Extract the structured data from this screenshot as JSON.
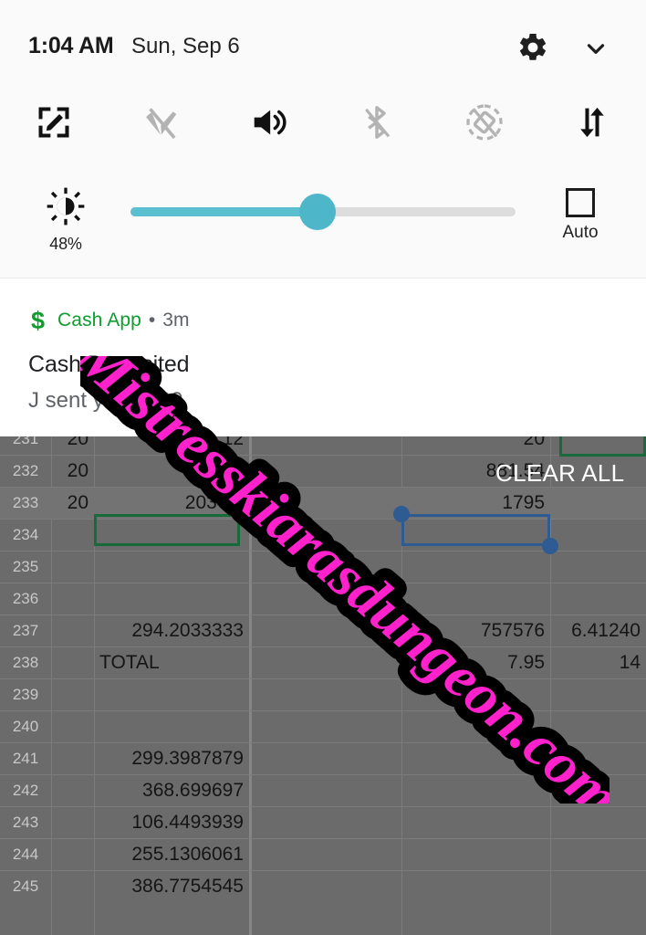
{
  "status_bar": {
    "time": "1:04 AM",
    "date": "Sun, Sep 6",
    "settings_icon": "gear-icon",
    "collapse_icon": "chevron-down-icon"
  },
  "quick_settings": {
    "tiles": [
      {
        "name": "screenshot-edit-tile",
        "icon": "screenshot-edit-icon",
        "active": true
      },
      {
        "name": "wifi-tile",
        "icon": "wifi-off-icon",
        "active": false
      },
      {
        "name": "sound-tile",
        "icon": "volume-up-icon",
        "active": true
      },
      {
        "name": "bluetooth-tile",
        "icon": "bluetooth-off-icon",
        "active": false
      },
      {
        "name": "auto-rotate-tile",
        "icon": "rotate-lock-icon",
        "active": false
      },
      {
        "name": "mobile-data-tile",
        "icon": "data-transfer-icon",
        "active": true
      }
    ],
    "brightness": {
      "icon": "brightness-icon",
      "percent_label": "48%",
      "value": 48,
      "auto_label": "Auto",
      "auto_checked": false,
      "fill_color": "#5bbfd0",
      "track_color": "#dcdcdc"
    }
  },
  "notification": {
    "app_icon": "dollar-sign-icon",
    "app_icon_glyph": "$",
    "app_name": "Cash App",
    "separator": "•",
    "time_ago": "3m",
    "title": "Cash Deposited",
    "body": "J                            sent you $100.",
    "app_color": "#0f9d2f"
  },
  "clear_all": {
    "label": "CLEAR ALL"
  },
  "watermark": {
    "text": "Mistresskiarasdungeon.com",
    "fill_color": "#ff22cc",
    "stroke_color": "#000000"
  },
  "spreadsheet": {
    "row_start": 231,
    "rows": [
      {
        "num": "231",
        "c1": "20",
        "c2": "12",
        "c3": "",
        "c4": "20",
        "c5": ""
      },
      {
        "num": "232",
        "c1": "20",
        "c2": "1058.1",
        "c3": "",
        "c4": "881.54",
        "c5": ""
      },
      {
        "num": "233",
        "c1": "20",
        "c2": "2034.9",
        "c3": "",
        "c4": "1795",
        "c5": ""
      },
      {
        "num": "234",
        "c1": "",
        "c2": "",
        "c3": "",
        "c4": "",
        "c5": ""
      },
      {
        "num": "235",
        "c1": "",
        "c2": "",
        "c3": "",
        "c4": "",
        "c5": ""
      },
      {
        "num": "236",
        "c1": "",
        "c2": "",
        "c3": "",
        "c4": "",
        "c5": ""
      },
      {
        "num": "237",
        "c1": "",
        "c2": "294.2033333",
        "c3": "",
        "c4": "757576",
        "c5": "6.41240"
      },
      {
        "num": "238",
        "c1": "",
        "c2": "TOTAL",
        "c3": "",
        "c4": "7.95",
        "c5": "14"
      },
      {
        "num": "239",
        "c1": "",
        "c2": "",
        "c3": "",
        "c4": "",
        "c5": ""
      },
      {
        "num": "240",
        "c1": "",
        "c2": "",
        "c3": "",
        "c4": "",
        "c5": ""
      },
      {
        "num": "241",
        "c1": "",
        "c2": "299.3987879",
        "c3": "",
        "c4": "",
        "c5": ""
      },
      {
        "num": "242",
        "c1": "",
        "c2": "368.699697",
        "c3": "",
        "c4": "",
        "c5": ""
      },
      {
        "num": "243",
        "c1": "",
        "c2": "106.4493939",
        "c3": "",
        "c4": "",
        "c5": ""
      },
      {
        "num": "244",
        "c1": "",
        "c2": "255.1306061",
        "c3": "",
        "c4": "",
        "c5": ""
      },
      {
        "num": "245",
        "c1": "",
        "c2": "386.7754545",
        "c3": "",
        "c4": "",
        "c5": ""
      }
    ],
    "selection_green_cell": "2034.9",
    "selection_blue_cell": "1795"
  }
}
